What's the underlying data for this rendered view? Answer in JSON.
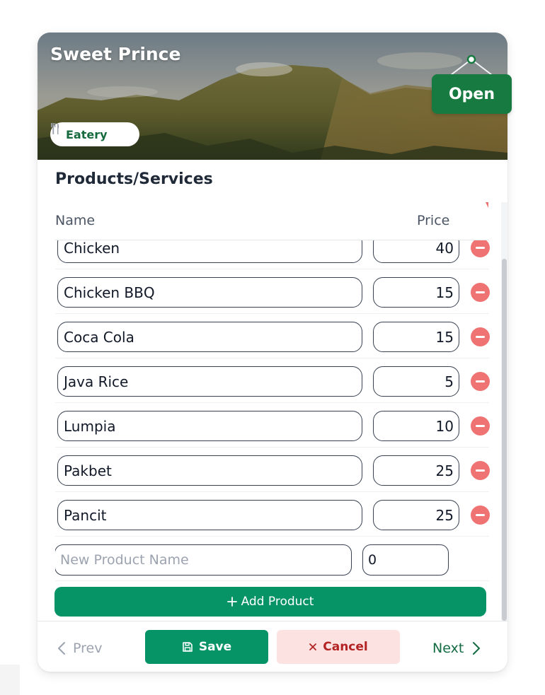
{
  "business": {
    "name": "Sweet Prince",
    "category": "Eatery",
    "status": "Open"
  },
  "section": {
    "title": "Products/Services"
  },
  "table": {
    "columns": {
      "name": "Name",
      "price": "Price"
    },
    "rows": [
      {
        "name": "Chicken",
        "price": "40"
      },
      {
        "name": "Chicken BBQ",
        "price": "15"
      },
      {
        "name": "Coca Cola",
        "price": "15"
      },
      {
        "name": "Java Rice",
        "price": "5"
      },
      {
        "name": "Lumpia",
        "price": "10"
      },
      {
        "name": "Pakbet",
        "price": "25"
      },
      {
        "name": "Pancit",
        "price": "25"
      }
    ],
    "new_row": {
      "name_placeholder": "New Product Name",
      "price_value": "0"
    }
  },
  "actions": {
    "add_product": "Add Product",
    "prev": "Prev",
    "save": "Save",
    "cancel": "Cancel",
    "next": "Next"
  },
  "colors": {
    "primary": "#069466",
    "sign": "#177b41",
    "danger": "#ef7373",
    "cancel_bg": "#fde2e2"
  },
  "icons": {
    "category": "utensils-icon",
    "remove": "minus-circle-icon",
    "add": "plus-icon",
    "save": "floppy-disk-icon",
    "cancel": "x-icon",
    "prev": "chevron-left-icon",
    "next": "chevron-right-icon"
  }
}
